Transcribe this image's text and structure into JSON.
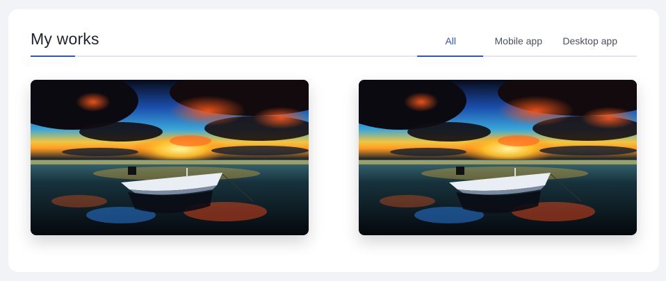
{
  "section": {
    "title": "My works"
  },
  "tabs": [
    {
      "label": "All",
      "active": true
    },
    {
      "label": "Mobile app",
      "active": false
    },
    {
      "label": "Desktop app",
      "active": false
    }
  ],
  "works": [
    {
      "image": "sunset-boat-lake-photo"
    },
    {
      "image": "sunset-boat-lake-photo"
    }
  ],
  "colors": {
    "accent": "#2f55c4",
    "title": "#1f2430",
    "tab_text": "#4a5060",
    "divider": "#e3e5ea",
    "page_bg": "#f2f3f6",
    "card_bg": "#ffffff"
  }
}
